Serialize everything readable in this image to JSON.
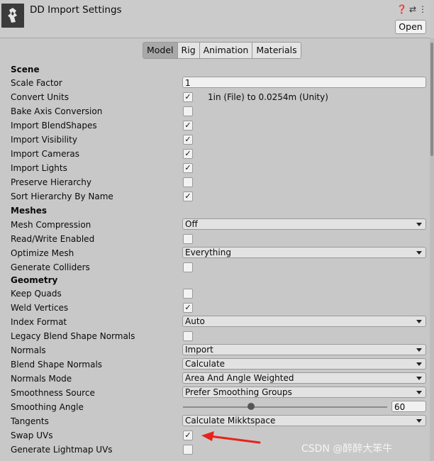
{
  "header": {
    "title": "DD Import Settings",
    "icons": [
      "help-icon",
      "preset-sliders-icon",
      "more-icon"
    ],
    "open_label": "Open"
  },
  "tabs": [
    {
      "label": "Model",
      "active": true
    },
    {
      "label": "Rig",
      "active": false
    },
    {
      "label": "Animation",
      "active": false
    },
    {
      "label": "Materials",
      "active": false
    }
  ],
  "scene": {
    "title": "Scene",
    "scale_factor": {
      "label": "Scale Factor",
      "value": "1"
    },
    "convert_units": {
      "label": "Convert Units",
      "checked": true,
      "note": "1in (File) to 0.0254m (Unity)"
    },
    "bake_axis": {
      "label": "Bake Axis Conversion",
      "checked": false
    },
    "import_blendshapes": {
      "label": "Import BlendShapes",
      "checked": true
    },
    "import_visibility": {
      "label": "Import Visibility",
      "checked": true
    },
    "import_cameras": {
      "label": "Import Cameras",
      "checked": true
    },
    "import_lights": {
      "label": "Import Lights",
      "checked": true
    },
    "preserve_hierarchy": {
      "label": "Preserve Hierarchy",
      "checked": false
    },
    "sort_hierarchy": {
      "label": "Sort Hierarchy By Name",
      "checked": true
    }
  },
  "meshes": {
    "title": "Meshes",
    "mesh_compression": {
      "label": "Mesh Compression",
      "value": "Off"
    },
    "read_write": {
      "label": "Read/Write Enabled",
      "checked": false
    },
    "optimize_mesh": {
      "label": "Optimize Mesh",
      "value": "Everything"
    },
    "generate_colliders": {
      "label": "Generate Colliders",
      "checked": false
    }
  },
  "geometry": {
    "title": "Geometry",
    "keep_quads": {
      "label": "Keep Quads",
      "checked": false
    },
    "weld_vertices": {
      "label": "Weld Vertices",
      "checked": true
    },
    "index_format": {
      "label": "Index Format",
      "value": "Auto"
    },
    "legacy_blend": {
      "label": "Legacy Blend Shape Normals",
      "checked": false
    },
    "normals": {
      "label": "Normals",
      "value": "Import"
    },
    "blend_normals": {
      "label": "Blend Shape Normals",
      "value": "Calculate"
    },
    "normals_mode": {
      "label": "Normals Mode",
      "value": "Area And Angle Weighted"
    },
    "smoothness_source": {
      "label": "Smoothness Source",
      "value": "Prefer Smoothing Groups"
    },
    "smoothing_angle": {
      "label": "Smoothing Angle",
      "value": "60",
      "min": 0,
      "max": 180
    },
    "tangents": {
      "label": "Tangents",
      "value": "Calculate Mikktspace"
    },
    "swap_uvs": {
      "label": "Swap UVs",
      "checked": true
    },
    "lightmap_uvs": {
      "label": "Generate Lightmap UVs",
      "checked": false
    }
  },
  "annotation": {
    "color": "#e8231b"
  },
  "watermark": "CSDN @醉醉大笨牛",
  "colors": {
    "tab_active": "#a8a8a8",
    "panel_bg": "#c8c8c8"
  }
}
